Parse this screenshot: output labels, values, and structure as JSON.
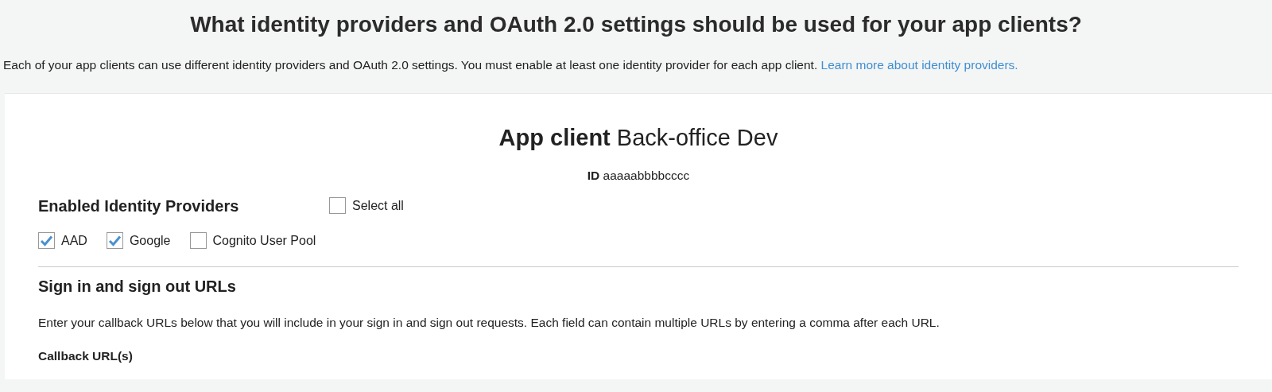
{
  "header": {
    "title": "What identity providers and OAuth 2.0 settings should be used for your app clients?",
    "description": "Each of your app clients can use different identity providers and OAuth 2.0 settings. You must enable at least one identity provider for each app client.",
    "link": "Learn more about identity providers."
  },
  "app_client": {
    "label": "App client",
    "name": "Back-office Dev",
    "id_label": "ID",
    "id": "aaaaabbbbcccc"
  },
  "providers": {
    "heading": "Enabled Identity Providers",
    "select_all": {
      "label": "Select all",
      "checked": false
    },
    "items": [
      {
        "label": "AAD",
        "checked": true
      },
      {
        "label": "Google",
        "checked": true
      },
      {
        "label": "Cognito User Pool",
        "checked": false
      }
    ]
  },
  "urls": {
    "heading": "Sign in and sign out URLs",
    "description": "Enter your callback URLs below that you will include in your sign in and sign out requests. Each field can contain multiple URLs by entering a comma after each URL.",
    "callback_label": "Callback URL(s)"
  }
}
